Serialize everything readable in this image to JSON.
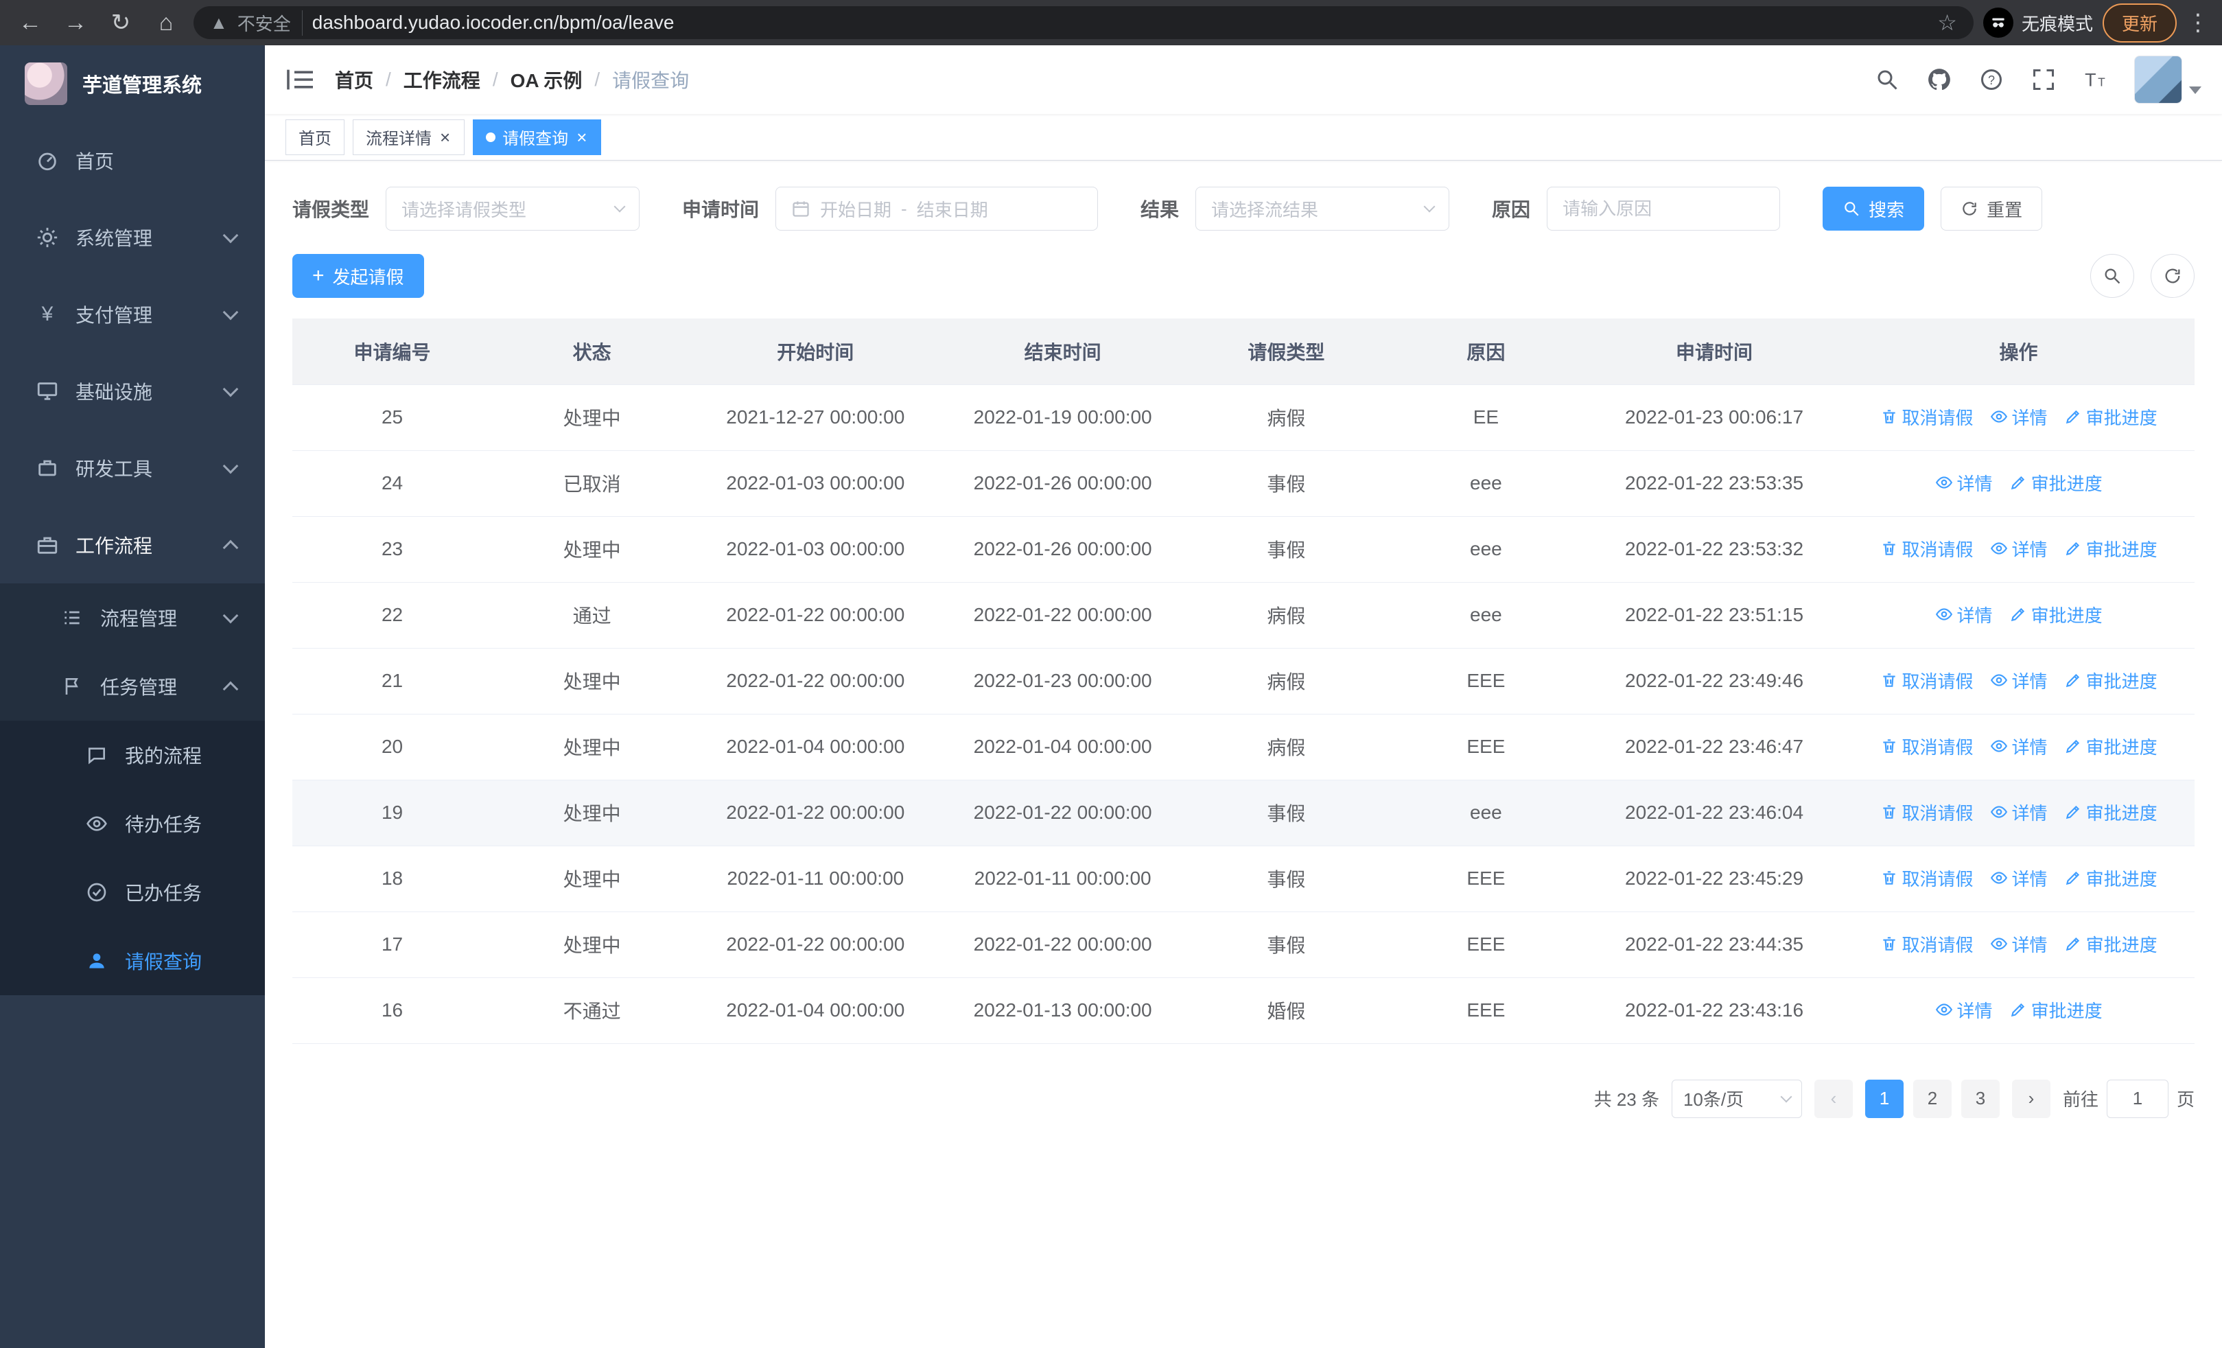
{
  "browser": {
    "security_label": "不安全",
    "url": "dashboard.yudao.iocoder.cn/bpm/oa/leave",
    "incognito_label": "无痕模式",
    "update_label": "更新"
  },
  "app": {
    "title": "芋道管理系统"
  },
  "colors": {
    "primary": "#409eff",
    "sidebar_bg": "#2d3a4d",
    "submenu_bg": "#232f3e",
    "table_header_bg": "#f2f3f5"
  },
  "sidebar": {
    "items": [
      {
        "label": "首页",
        "icon": "dashboard-icon"
      },
      {
        "label": "系统管理",
        "icon": "gear-icon"
      },
      {
        "label": "支付管理",
        "icon": "yen-icon"
      },
      {
        "label": "基础设施",
        "icon": "infrastructure-icon"
      },
      {
        "label": "研发工具",
        "icon": "tools-icon"
      },
      {
        "label": "工作流程",
        "icon": "workflow-icon"
      }
    ],
    "workflow_children": [
      {
        "label": "流程管理",
        "icon": "process-list-icon"
      },
      {
        "label": "任务管理",
        "icon": "task-flag-icon"
      }
    ],
    "task_children": [
      {
        "label": "我的流程",
        "icon": "chat-icon"
      },
      {
        "label": "待办任务",
        "icon": "eye-icon"
      },
      {
        "label": "已办任务",
        "icon": "check-circle-icon"
      },
      {
        "label": "请假查询",
        "icon": "person-icon"
      }
    ]
  },
  "header": {
    "breadcrumb": [
      "首页",
      "工作流程",
      "OA 示例",
      "请假查询"
    ]
  },
  "tabs": [
    {
      "label": "首页"
    },
    {
      "label": "流程详情"
    },
    {
      "label": "请假查询"
    }
  ],
  "filters": {
    "leave_type": {
      "label": "请假类型",
      "placeholder": "请选择请假类型"
    },
    "apply_time": {
      "label": "申请时间",
      "start_placeholder": "开始日期",
      "separator": "-",
      "end_placeholder": "结束日期"
    },
    "result": {
      "label": "结果",
      "placeholder": "请选择流结果"
    },
    "reason": {
      "label": "原因",
      "placeholder": "请输入原因"
    },
    "search_label": "搜索",
    "reset_label": "重置"
  },
  "toolbar": {
    "create_label": "发起请假"
  },
  "table": {
    "columns": [
      "申请编号",
      "状态",
      "开始时间",
      "结束时间",
      "请假类型",
      "原因",
      "申请时间",
      "操作"
    ],
    "cell_names": [
      "apply-no",
      "status",
      "start-time",
      "end-time",
      "leave-type",
      "reason",
      "apply-time"
    ],
    "action_defs": {
      "cancel": {
        "label": "取消请假",
        "icon": "delete-icon"
      },
      "detail": {
        "label": "详情",
        "icon": "view-eye-icon"
      },
      "progress": {
        "label": "审批进度",
        "icon": "edit-icon"
      }
    },
    "rows": [
      {
        "id": "25",
        "status": "处理中",
        "start": "2021-12-27 00:00:00",
        "end": "2022-01-19 00:00:00",
        "type": "病假",
        "reason": "EE",
        "applied": "2022-01-23 00:06:17",
        "actions": [
          "cancel",
          "detail",
          "progress"
        ],
        "highlighted": false
      },
      {
        "id": "24",
        "status": "已取消",
        "start": "2022-01-03 00:00:00",
        "end": "2022-01-26 00:00:00",
        "type": "事假",
        "reason": "eee",
        "applied": "2022-01-22 23:53:35",
        "actions": [
          "detail",
          "progress"
        ],
        "highlighted": false
      },
      {
        "id": "23",
        "status": "处理中",
        "start": "2022-01-03 00:00:00",
        "end": "2022-01-26 00:00:00",
        "type": "事假",
        "reason": "eee",
        "applied": "2022-01-22 23:53:32",
        "actions": [
          "cancel",
          "detail",
          "progress"
        ],
        "highlighted": false
      },
      {
        "id": "22",
        "status": "通过",
        "start": "2022-01-22 00:00:00",
        "end": "2022-01-22 00:00:00",
        "type": "病假",
        "reason": "eee",
        "applied": "2022-01-22 23:51:15",
        "actions": [
          "detail",
          "progress"
        ],
        "highlighted": false
      },
      {
        "id": "21",
        "status": "处理中",
        "start": "2022-01-22 00:00:00",
        "end": "2022-01-23 00:00:00",
        "type": "病假",
        "reason": "EEE",
        "applied": "2022-01-22 23:49:46",
        "actions": [
          "cancel",
          "detail",
          "progress"
        ],
        "highlighted": false
      },
      {
        "id": "20",
        "status": "处理中",
        "start": "2022-01-04 00:00:00",
        "end": "2022-01-04 00:00:00",
        "type": "病假",
        "reason": "EEE",
        "applied": "2022-01-22 23:46:47",
        "actions": [
          "cancel",
          "detail",
          "progress"
        ],
        "highlighted": false
      },
      {
        "id": "19",
        "status": "处理中",
        "start": "2022-01-22 00:00:00",
        "end": "2022-01-22 00:00:00",
        "type": "事假",
        "reason": "eee",
        "applied": "2022-01-22 23:46:04",
        "actions": [
          "cancel",
          "detail",
          "progress"
        ],
        "highlighted": true
      },
      {
        "id": "18",
        "status": "处理中",
        "start": "2022-01-11 00:00:00",
        "end": "2022-01-11 00:00:00",
        "type": "事假",
        "reason": "EEE",
        "applied": "2022-01-22 23:45:29",
        "actions": [
          "cancel",
          "detail",
          "progress"
        ],
        "highlighted": false
      },
      {
        "id": "17",
        "status": "处理中",
        "start": "2022-01-22 00:00:00",
        "end": "2022-01-22 00:00:00",
        "type": "事假",
        "reason": "EEE",
        "applied": "2022-01-22 23:44:35",
        "actions": [
          "cancel",
          "detail",
          "progress"
        ],
        "highlighted": false
      },
      {
        "id": "16",
        "status": "不通过",
        "start": "2022-01-04 00:00:00",
        "end": "2022-01-13 00:00:00",
        "type": "婚假",
        "reason": "EEE",
        "applied": "2022-01-22 23:43:16",
        "actions": [
          "detail",
          "progress"
        ],
        "highlighted": false
      }
    ]
  },
  "pagination": {
    "total_label": "共 23 条",
    "page_size": "10条/页",
    "pages": [
      "1",
      "2",
      "3"
    ],
    "active_page": "1",
    "goto_label": "前往",
    "goto_value": "1",
    "goto_suffix": "页"
  }
}
